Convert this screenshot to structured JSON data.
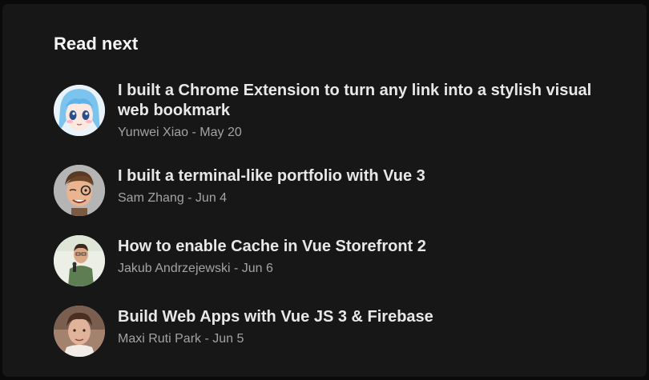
{
  "read_next": {
    "heading": "Read next",
    "articles": [
      {
        "title": "I built a Chrome Extension to turn any link into a stylish visual web bookmark",
        "author": "Yunwei Xiao",
        "date": "May 20",
        "meta": "Yunwei Xiao - May 20",
        "avatar_icon": "anime-avatar-icon"
      },
      {
        "title": "I built a terminal-like portfolio with Vue 3",
        "author": "Sam Zhang",
        "date": "Jun 4",
        "meta": "Sam Zhang - Jun 4",
        "avatar_icon": "memoji-avatar-icon"
      },
      {
        "title": "How to enable Cache in Vue Storefront 2",
        "author": "Jakub Andrzejewski",
        "date": "Jun 6",
        "meta": "Jakub Andrzejewski - Jun 6",
        "avatar_icon": "speaker-photo-avatar-icon"
      },
      {
        "title": "Build Web Apps with Vue JS 3 & Firebase",
        "author": "Maxi Ruti Park",
        "date": "Jun 5",
        "meta": "Maxi Ruti Park - Jun 5",
        "avatar_icon": "portrait-avatar-icon"
      }
    ]
  },
  "colors": {
    "background": "#0a0a0a",
    "panel": "#171717",
    "title_text": "#e8e8e8",
    "meta_text": "#a3a3a3"
  }
}
